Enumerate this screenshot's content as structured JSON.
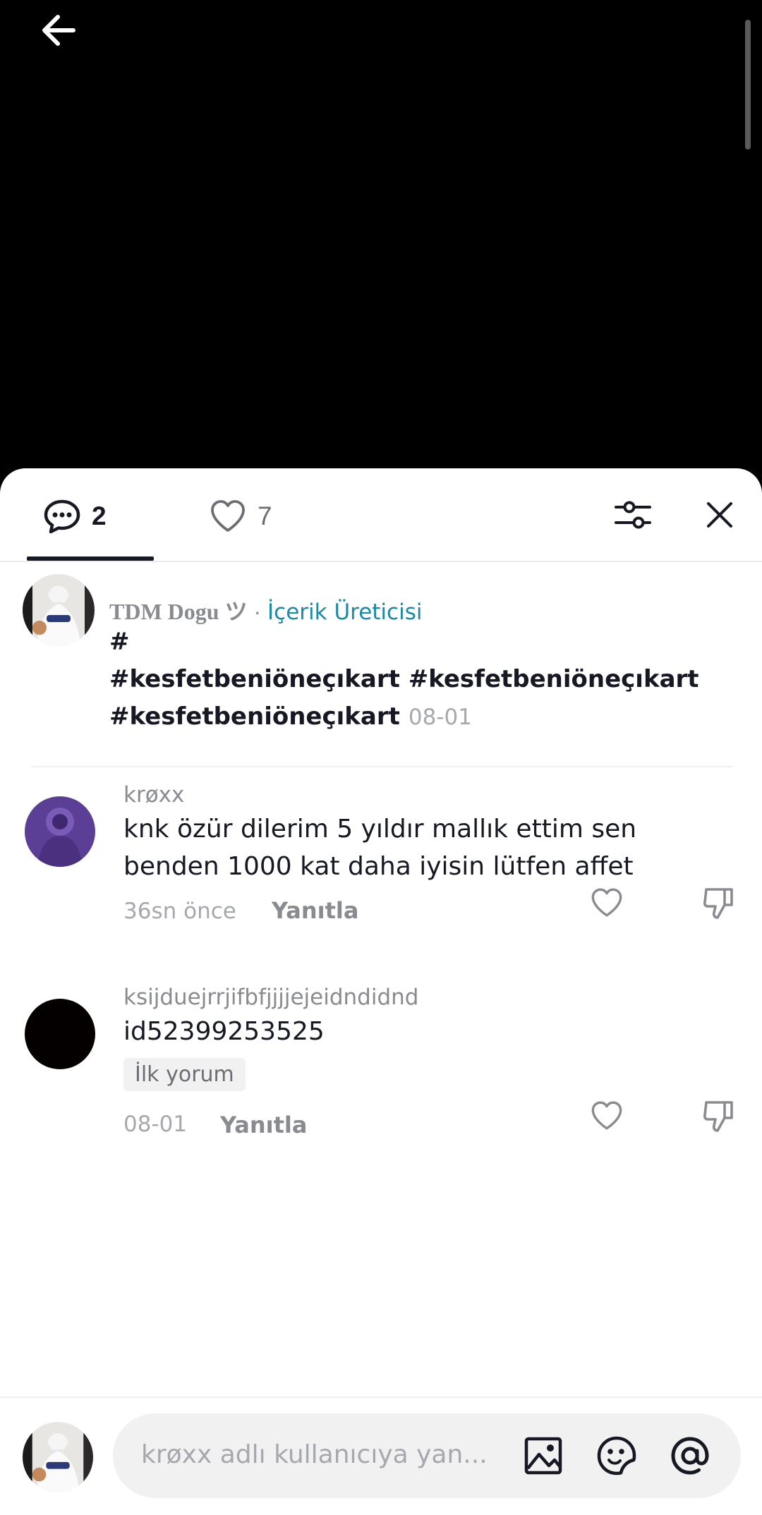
{
  "header": {
    "back_icon": "arrow-left-icon"
  },
  "tabs": [
    {
      "icon": "comment-bubble-icon",
      "count": "2",
      "active": true
    },
    {
      "icon": "heart-outline-icon",
      "count": "7",
      "active": false
    }
  ],
  "actions": {
    "filter_icon": "sliders-icon",
    "close_icon": "close-icon"
  },
  "creator_post": {
    "name": "TDM Dogu ツ",
    "separator": " · ",
    "role": "İçerik Üreticisi",
    "caption_line1": "#",
    "caption_line2": "#kesfetbeniöneçıkart #kesfetbeniöneçıkart",
    "caption_line3": "#kesfetbeniöneçıkart",
    "timestamp": "08-01"
  },
  "comments": [
    {
      "username": "krøxx",
      "text_line1": "knk özür dilerim 5 yıldır mallık ettim sen",
      "text_line2": "benden 1000 kat daha iyisin lütfen affet",
      "time": "36sn önce",
      "reply_label": "Yanıtla",
      "avatar_color": "#5b3f96"
    },
    {
      "username": "ksijduejrrjifbfjjjjejeidndidnd",
      "text": "id52399253525",
      "badge": "İlk yorum",
      "time": "08-01",
      "reply_label": "Yanıtla",
      "avatar_color": "#050000"
    }
  ],
  "composer": {
    "placeholder": "krøxx adlı kullanıcıya yan...",
    "icons": [
      "image-icon",
      "sticker-icon",
      "mention-icon"
    ]
  },
  "colors": {
    "accent": "#1a8aa6",
    "text": "#161823",
    "muted": "#8a8b91"
  }
}
